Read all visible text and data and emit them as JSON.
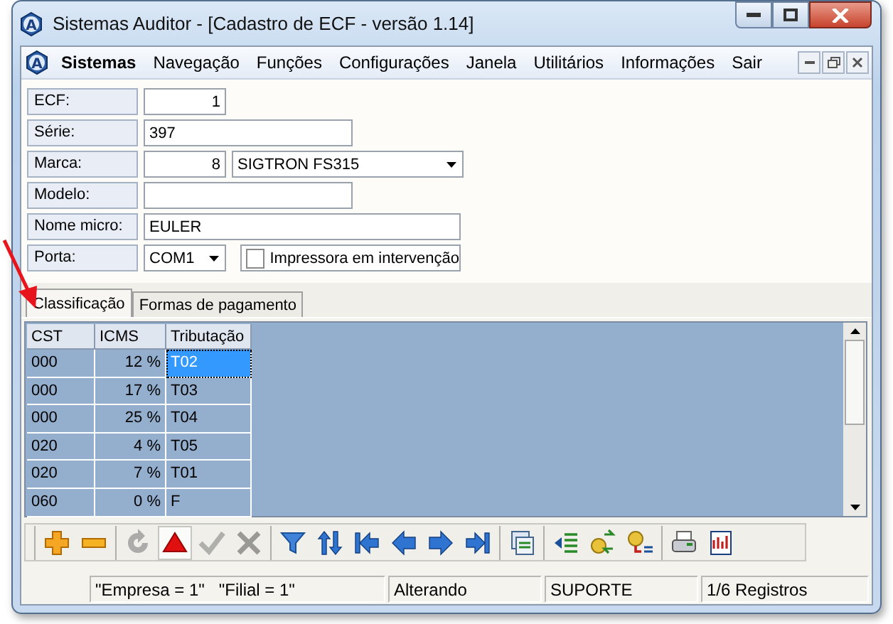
{
  "window": {
    "title": "Sistemas Auditor - [Cadastro de ECF - versão 1.14]",
    "logo": "A"
  },
  "menu": {
    "logo": "A",
    "items": [
      {
        "label": "Sistemas"
      },
      {
        "label": "Navegação"
      },
      {
        "label": "Funções"
      },
      {
        "label": "Configurações"
      },
      {
        "label": "Janela"
      },
      {
        "label": "Utilitários"
      },
      {
        "label": "Informações"
      },
      {
        "label": "Sair"
      }
    ]
  },
  "form": {
    "ecf": {
      "label": "ECF:",
      "value": "1"
    },
    "serie": {
      "label": "Série:",
      "value": "397"
    },
    "marca": {
      "label": "Marca:",
      "code": "8",
      "value": "SIGTRON FS315"
    },
    "modelo": {
      "label": "Modelo:"
    },
    "nome_micro": {
      "label": "Nome micro:",
      "value": "EULER"
    },
    "porta": {
      "label": "Porta:",
      "value": "COM1"
    },
    "intervencao": {
      "label": "Impressora em intervenção",
      "checked": false
    }
  },
  "tabs": [
    {
      "label": "Classificação",
      "selected": true
    },
    {
      "label": "Formas de pagamento",
      "selected": false
    }
  ],
  "table": {
    "columns": [
      "CST",
      "ICMS",
      "Tributação"
    ],
    "rows": [
      {
        "cst": "000",
        "icms": "12 %",
        "tributacao": "T02",
        "selected": true
      },
      {
        "cst": "000",
        "icms": "17 %",
        "tributacao": "T03",
        "selected": false
      },
      {
        "cst": "000",
        "icms": "25 %",
        "tributacao": "T04",
        "selected": false
      },
      {
        "cst": "020",
        "icms": "4 %",
        "tributacao": "T05",
        "selected": false
      },
      {
        "cst": "020",
        "icms": "7 %",
        "tributacao": "T01",
        "selected": false
      },
      {
        "cst": "060",
        "icms": "0 %",
        "tributacao": "F",
        "selected": false
      }
    ]
  },
  "toolbar": {
    "groups": [
      [
        {
          "kind": "add",
          "disabled": false,
          "pressed": false
        },
        {
          "kind": "remove",
          "disabled": false,
          "pressed": false
        }
      ],
      [
        {
          "kind": "refresh",
          "disabled": true,
          "pressed": false
        },
        {
          "kind": "alert",
          "disabled": false,
          "pressed": true
        },
        {
          "kind": "confirm",
          "disabled": true,
          "pressed": false
        },
        {
          "kind": "cancel",
          "disabled": true,
          "pressed": false
        }
      ],
      [
        {
          "kind": "filter",
          "disabled": false,
          "pressed": false
        },
        {
          "kind": "sort",
          "disabled": false,
          "pressed": false
        },
        {
          "kind": "first",
          "disabled": false,
          "pressed": false
        },
        {
          "kind": "previous",
          "disabled": false,
          "pressed": false
        },
        {
          "kind": "next",
          "disabled": false,
          "pressed": false
        },
        {
          "kind": "last",
          "disabled": false,
          "pressed": false
        }
      ],
      [
        {
          "kind": "report",
          "disabled": false,
          "pressed": false
        }
      ],
      [
        {
          "kind": "import",
          "disabled": false,
          "pressed": false
        },
        {
          "kind": "transfer",
          "disabled": false,
          "pressed": false
        },
        {
          "kind": "export",
          "disabled": false,
          "pressed": false
        }
      ],
      [
        {
          "kind": "print",
          "disabled": false,
          "pressed": false
        },
        {
          "kind": "chart",
          "disabled": false,
          "pressed": false
        }
      ]
    ]
  },
  "status_bar": {
    "panels": [
      {
        "texts": [
          "\"Empresa = 1\"",
          "\"Filial = 1\""
        ]
      },
      {
        "texts": [
          "Alterando"
        ]
      },
      {
        "texts": [
          "SUPORTE"
        ]
      },
      {
        "texts": [
          "1/6 Registros"
        ]
      }
    ]
  }
}
